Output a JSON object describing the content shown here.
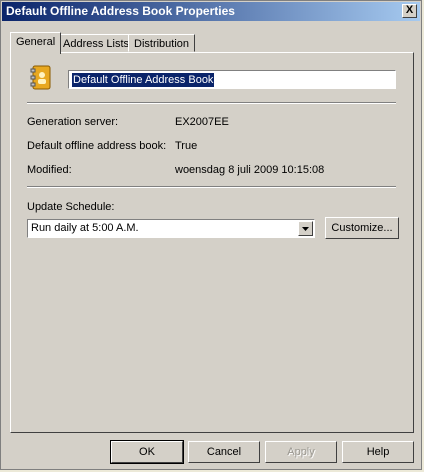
{
  "window": {
    "title": "Default Offline Address Book Properties",
    "close_label": "X"
  },
  "tabs": [
    {
      "label": "General",
      "active": true
    },
    {
      "label": "Address Lists",
      "active": false
    },
    {
      "label": "Distribution",
      "active": false
    }
  ],
  "general": {
    "name_value": "Default Offline Address Book",
    "generation_server_label": "Generation server:",
    "generation_server_value": "EX2007EE",
    "default_oab_label": "Default offline address book:",
    "default_oab_value": "True",
    "modified_label": "Modified:",
    "modified_value": "woensdag 8 juli 2009 10:15:08",
    "update_schedule_label": "Update Schedule:",
    "update_schedule_value": "Run daily at 5:00 A.M.",
    "customize_label": "Customize..."
  },
  "footer": {
    "ok": "OK",
    "cancel": "Cancel",
    "apply": "Apply",
    "help": "Help"
  },
  "icons": {
    "book": "address-book-icon",
    "dropdown": "chevron-down-icon",
    "close": "close-icon"
  }
}
